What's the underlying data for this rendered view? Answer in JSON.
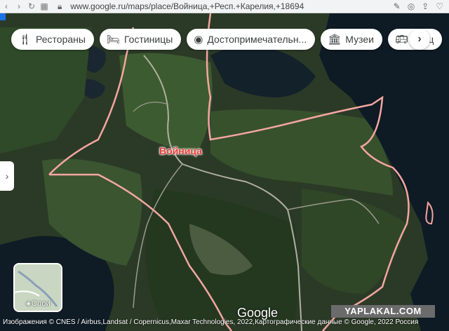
{
  "browser": {
    "url": "www.google.ru/maps/place/Войница,+Респ.+Карелия,+18694"
  },
  "chips": [
    {
      "label": "Рестораны",
      "icon": "restaurant-icon"
    },
    {
      "label": "Гостиницы",
      "icon": "hotel-icon"
    },
    {
      "label": "Достопримечательн...",
      "icon": "attraction-icon"
    },
    {
      "label": "Музеи",
      "icon": "museum-icon"
    },
    {
      "label": "Общ",
      "icon": "transit-icon"
    }
  ],
  "map": {
    "place_label": "Войница",
    "layers_label": "Слои",
    "attribution": "Изображения © CNES / Airbus,Landsat / Copernicus,Maxar Technologies, 2022,Картографические данные © Google, 2022",
    "attribution_region": "Россия",
    "logo": "Google",
    "boundary_color": "#f4a6a0",
    "label_color": "#e8403a"
  },
  "watermark": "YAPLAKAL.COM"
}
